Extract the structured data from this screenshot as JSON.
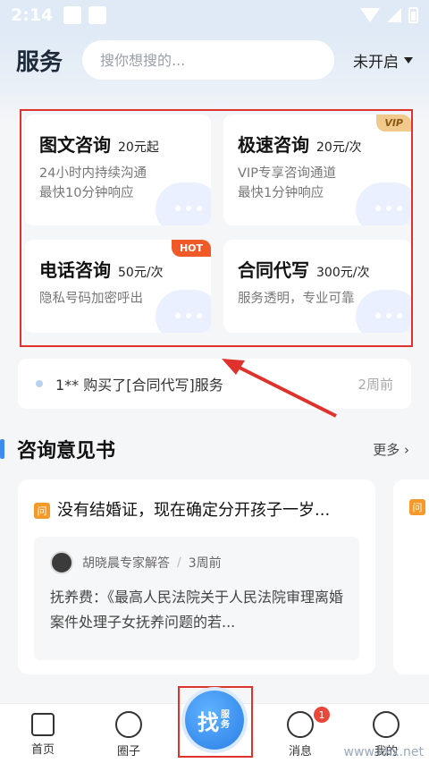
{
  "status_bar": {
    "time": "2:14"
  },
  "header": {
    "title": "服务",
    "search_placeholder": "搜你想搜的...",
    "location": "未开启"
  },
  "services": [
    {
      "name": "图文咨询",
      "price": "20元起",
      "desc1": "24小时内持续沟通",
      "desc2": "最快10分钟响应",
      "badge": ""
    },
    {
      "name": "极速咨询",
      "price": "20元/次",
      "desc1": "VIP专享咨询通道",
      "desc2": "最快1分钟响应",
      "badge": "VIP"
    },
    {
      "name": "电话咨询",
      "price": "50元/次",
      "desc1": "隐私号码加密呼出",
      "desc2": "",
      "badge": "HOT"
    },
    {
      "name": "合同代写",
      "price": "300元/次",
      "desc1": "服务透明，专业可靠",
      "desc2": "",
      "badge": ""
    }
  ],
  "ticker": {
    "text": "1** 购买了[合同代写]服务",
    "time": "2周前"
  },
  "section": {
    "title": "咨询意见书",
    "more": "更多"
  },
  "opinion": {
    "q_icon": "问",
    "question": "没有结婚证，现在确定分开孩子一岁...",
    "answerer": "胡晓晨专家解答",
    "sep": "/",
    "time": "3周前",
    "body": "抚养费：《最高人民法院关于人民法院审理离婚案件处理子女抚养问题的若..."
  },
  "nav": {
    "home": "首页",
    "circle": "圈子",
    "find_big": "找",
    "find_small": "服务",
    "messages": "消息",
    "messages_badge": "1",
    "mine": "我的"
  },
  "watermark": "www.kkx.net"
}
